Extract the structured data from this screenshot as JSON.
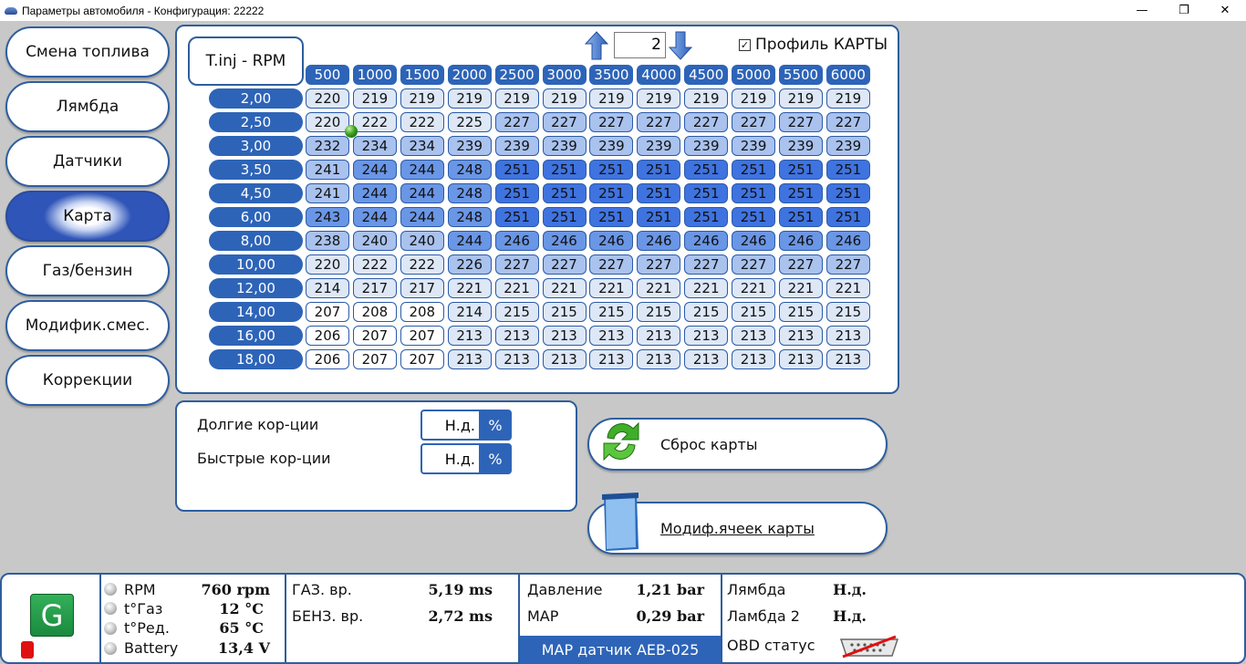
{
  "window": {
    "title": "Параметры автомобиля - Конфигурация: 22222",
    "minimize_glyph": "—",
    "maximize_glyph": "❐",
    "close_glyph": "✕"
  },
  "nav": {
    "items": [
      {
        "label": "Смена топлива",
        "active": false
      },
      {
        "label": "Лямбда",
        "active": false
      },
      {
        "label": "Датчики",
        "active": false
      },
      {
        "label": "Карта",
        "active": true
      },
      {
        "label": "Газ/бензин",
        "active": false
      },
      {
        "label": "Модифик.смес.",
        "active": false
      },
      {
        "label": "Коррекции",
        "active": false
      }
    ]
  },
  "map": {
    "label": "T.inj - RPM",
    "profile_number": "2",
    "profile_checked": true,
    "profile_check_glyph": "✓",
    "profile_label": "Профиль КАРТЫ",
    "columns": [
      "500",
      "1000",
      "1500",
      "2000",
      "2500",
      "3000",
      "3500",
      "4000",
      "4500",
      "5000",
      "5500",
      "6000"
    ],
    "rows": [
      {
        "label": "2,00",
        "values": [
          "220",
          "219",
          "219",
          "219",
          "219",
          "219",
          "219",
          "219",
          "219",
          "219",
          "219",
          "219"
        ]
      },
      {
        "label": "2,50",
        "values": [
          "220",
          "222",
          "222",
          "225",
          "227",
          "227",
          "227",
          "227",
          "227",
          "227",
          "227",
          "227"
        ]
      },
      {
        "label": "3,00",
        "values": [
          "232",
          "234",
          "234",
          "239",
          "239",
          "239",
          "239",
          "239",
          "239",
          "239",
          "239",
          "239"
        ]
      },
      {
        "label": "3,50",
        "values": [
          "241",
          "244",
          "244",
          "248",
          "251",
          "251",
          "251",
          "251",
          "251",
          "251",
          "251",
          "251"
        ]
      },
      {
        "label": "4,50",
        "values": [
          "241",
          "244",
          "244",
          "248",
          "251",
          "251",
          "251",
          "251",
          "251",
          "251",
          "251",
          "251"
        ]
      },
      {
        "label": "6,00",
        "values": [
          "243",
          "244",
          "244",
          "248",
          "251",
          "251",
          "251",
          "251",
          "251",
          "251",
          "251",
          "251"
        ]
      },
      {
        "label": "8,00",
        "values": [
          "238",
          "240",
          "240",
          "244",
          "246",
          "246",
          "246",
          "246",
          "246",
          "246",
          "246",
          "246"
        ]
      },
      {
        "label": "10,00",
        "values": [
          "220",
          "222",
          "222",
          "226",
          "227",
          "227",
          "227",
          "227",
          "227",
          "227",
          "227",
          "227"
        ]
      },
      {
        "label": "12,00",
        "values": [
          "214",
          "217",
          "217",
          "221",
          "221",
          "221",
          "221",
          "221",
          "221",
          "221",
          "221",
          "221"
        ]
      },
      {
        "label": "14,00",
        "values": [
          "207",
          "208",
          "208",
          "214",
          "215",
          "215",
          "215",
          "215",
          "215",
          "215",
          "215",
          "215"
        ]
      },
      {
        "label": "16,00",
        "values": [
          "206",
          "207",
          "207",
          "213",
          "213",
          "213",
          "213",
          "213",
          "213",
          "213",
          "213",
          "213"
        ]
      },
      {
        "label": "18,00",
        "values": [
          "206",
          "207",
          "207",
          "213",
          "213",
          "213",
          "213",
          "213",
          "213",
          "213",
          "213",
          "213"
        ]
      }
    ],
    "colors": {
      "header": "#2d64b8",
      "cell_light": "#ffffff",
      "cell_pale": "#dde7f6",
      "cell_mid": "#a9c2ee",
      "cell_blue": "#6a96e6",
      "cell_dark": "#3f73df"
    }
  },
  "corrections": {
    "long_label": "Долгие кор-ции",
    "long_value": "Н.д.",
    "long_unit": "%",
    "short_label": "Быстрые кор-ции",
    "short_value": "Н.д.",
    "short_unit": "%"
  },
  "actions": {
    "reset_label": "Сброс карты",
    "modify_label": "Модиф.ячеек карты"
  },
  "status": {
    "rpm_label": "RPM",
    "rpm_value": "760 rpm",
    "gas_temp_label": "t°Газ",
    "gas_temp_value": "12 °C",
    "red_temp_label": "t°Ред.",
    "red_temp_value": "65 °C",
    "battery_label": "Battery",
    "battery_value": "13,4 V",
    "gas_time_label": "ГАЗ. вр.",
    "gas_time_value": "5,19 ms",
    "petrol_time_label": "БЕНЗ. вр.",
    "petrol_time_value": "2,72 ms",
    "pressure_label": "Давление",
    "pressure_value": "1,21 bar",
    "map_label": "MAP",
    "map_value": "0,29 bar",
    "map_sensor": "MAP датчик AEB-025",
    "lambda_label": "Лямбда",
    "lambda_value": "Н.д.",
    "lambda2_label": "Ламбда 2",
    "lambda2_value": "Н.д.",
    "obd_label": "OBD статус",
    "fuel_indicator": "G"
  }
}
